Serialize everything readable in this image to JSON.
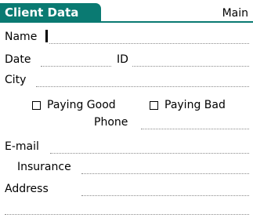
{
  "header": {
    "title": "Client Data",
    "menu_label": "Main"
  },
  "form": {
    "name_label": "Name",
    "name_value": "",
    "date_label": "Date",
    "id_label": "ID",
    "city_label": "City",
    "paying_good_label": "Paying Good",
    "paying_good_checked": false,
    "paying_bad_label": "Paying Bad",
    "paying_bad_checked": false,
    "phone_label": "Phone",
    "email_label": "E-mail",
    "insurance_label": "Insurance",
    "address_label": "Address"
  },
  "colors": {
    "accent": "#0a7a72",
    "field_dots": "#8a8a8a"
  }
}
